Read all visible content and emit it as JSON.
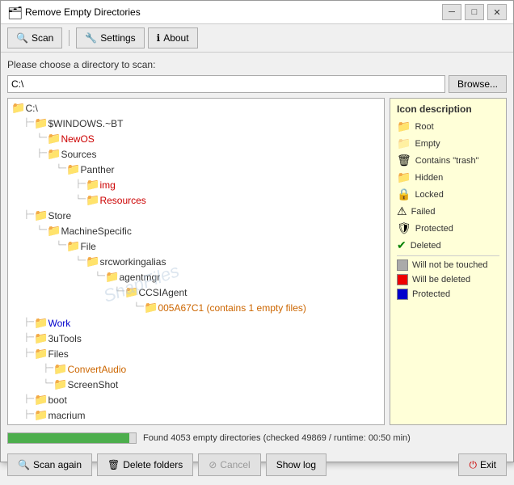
{
  "window": {
    "title": "Remove Empty Directories",
    "icon": "🗂"
  },
  "toolbar": {
    "scan_label": "Scan",
    "settings_label": "Settings",
    "about_label": "About"
  },
  "dir_chooser": {
    "label": "Please choose a directory to scan:",
    "value": "C:\\",
    "browse_label": "Browse..."
  },
  "tree": {
    "watermark": "SnapFiles"
  },
  "tree_nodes": [
    {
      "id": 0,
      "indent": 0,
      "icon": "folder",
      "label": "C:\\",
      "color": "normal",
      "connectors": ""
    },
    {
      "id": 1,
      "indent": 1,
      "icon": "folder-locked",
      "label": "$WINDOWS.~BT",
      "color": "normal",
      "connectors": "├─"
    },
    {
      "id": 2,
      "indent": 2,
      "icon": "folder-red",
      "label": "NewOS",
      "color": "red",
      "connectors": "│  └─"
    },
    {
      "id": 3,
      "indent": 2,
      "icon": "folder",
      "label": "Sources",
      "color": "normal",
      "connectors": "│     ├─"
    },
    {
      "id": 4,
      "indent": 3,
      "icon": "folder",
      "label": "Panther",
      "color": "normal",
      "connectors": "│     │  └─"
    },
    {
      "id": 5,
      "indent": 4,
      "icon": "folder-red",
      "label": "img",
      "color": "red",
      "connectors": "│     │     ├─"
    },
    {
      "id": 6,
      "indent": 4,
      "icon": "folder-red",
      "label": "Resources",
      "color": "red",
      "connectors": "│     │     └─"
    },
    {
      "id": 7,
      "indent": 1,
      "icon": "folder",
      "label": "Store",
      "color": "normal",
      "connectors": "├─"
    },
    {
      "id": 8,
      "indent": 2,
      "icon": "folder-locked",
      "label": "MachineSpecific",
      "color": "normal",
      "connectors": "│  └─"
    },
    {
      "id": 9,
      "indent": 3,
      "icon": "folder",
      "label": "File",
      "color": "normal",
      "connectors": "│     └─"
    },
    {
      "id": 10,
      "indent": 4,
      "icon": "folder-locked",
      "label": "srcworkingalias",
      "color": "normal",
      "connectors": "│        └─"
    },
    {
      "id": 11,
      "indent": 5,
      "icon": "folder",
      "label": "agentmgr",
      "color": "normal",
      "connectors": "│           └─"
    },
    {
      "id": 12,
      "indent": 6,
      "icon": "folder-locked",
      "label": "CCSIAgent",
      "color": "normal",
      "connectors": "│              └─"
    },
    {
      "id": 13,
      "indent": 7,
      "icon": "folder-orange",
      "label": "005A67C1 (contains 1 empty files)",
      "color": "orange",
      "connectors": "│                 └─"
    },
    {
      "id": 14,
      "indent": 1,
      "icon": "folder",
      "label": "Work",
      "color": "blue-link",
      "connectors": "├─"
    },
    {
      "id": 15,
      "indent": 1,
      "icon": "folder",
      "label": "3uTools",
      "color": "normal",
      "connectors": "├─"
    },
    {
      "id": 16,
      "indent": 1,
      "icon": "folder",
      "label": "Files",
      "color": "normal",
      "connectors": "├─"
    },
    {
      "id": 17,
      "indent": 2,
      "icon": "folder-orange",
      "label": "ConvertAudio",
      "color": "orange",
      "connectors": "│  ├─"
    },
    {
      "id": 18,
      "indent": 2,
      "icon": "folder",
      "label": "ScreenShot",
      "color": "normal",
      "connectors": "│  └─"
    },
    {
      "id": 19,
      "indent": 1,
      "icon": "folder",
      "label": "boot",
      "color": "normal",
      "connectors": "├─"
    },
    {
      "id": 20,
      "indent": 1,
      "icon": "folder-locked",
      "label": "macrium",
      "color": "normal",
      "connectors": "├─"
    }
  ],
  "icon_legend": {
    "title": "Icon description",
    "items": [
      {
        "icon": "root",
        "label": "Root"
      },
      {
        "icon": "empty",
        "label": "Empty"
      },
      {
        "icon": "trash",
        "label": "Contains \"trash\""
      },
      {
        "icon": "hidden",
        "label": "Hidden"
      },
      {
        "icon": "locked",
        "label": "Locked"
      },
      {
        "icon": "failed",
        "label": "Failed"
      },
      {
        "icon": "protected",
        "label": "Protected"
      },
      {
        "icon": "deleted",
        "label": "Deleted"
      }
    ],
    "swatches": [
      {
        "color": "gray",
        "label": "Will not be touched"
      },
      {
        "color": "red",
        "label": "Will be deleted"
      },
      {
        "color": "blue",
        "label": "Protected"
      }
    ]
  },
  "progress": {
    "percent": 95,
    "text": "Found 4053 empty directories (checked 49869 / runtime: 00:50 min)"
  },
  "footer": {
    "scan_again": "Scan again",
    "delete_folders": "Delete folders",
    "cancel": "Cancel",
    "show_log": "Show log",
    "exit": "Exit"
  }
}
